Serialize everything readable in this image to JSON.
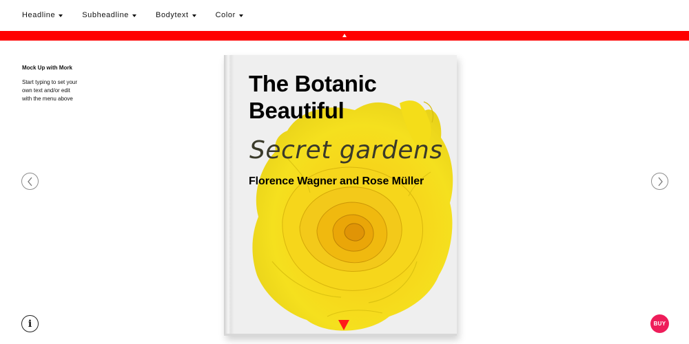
{
  "menu": {
    "items": [
      {
        "label": "Headline"
      },
      {
        "label": "Subheadline"
      },
      {
        "label": "Bodytext"
      },
      {
        "label": "Color"
      }
    ]
  },
  "info": {
    "title": "Mock Up with Mork",
    "text": "Start typing to set your own text and/or edit with the menu above"
  },
  "book": {
    "headline": "The Botanic Beautiful",
    "subheadline": "Secret gardens",
    "bodytext": "Florence Wagner and Rose Müller"
  },
  "buttons": {
    "buy": "BUY",
    "info": "i"
  },
  "colors": {
    "accent": "#ff0000",
    "buy": "#ee1d5a",
    "rose": "#f5dc15"
  },
  "icons": {
    "prev": "chevron-left-icon",
    "next": "chevron-right-icon",
    "info": "info-icon",
    "collapse": "triangle-up-icon",
    "scroll": "triangle-down-icon"
  }
}
